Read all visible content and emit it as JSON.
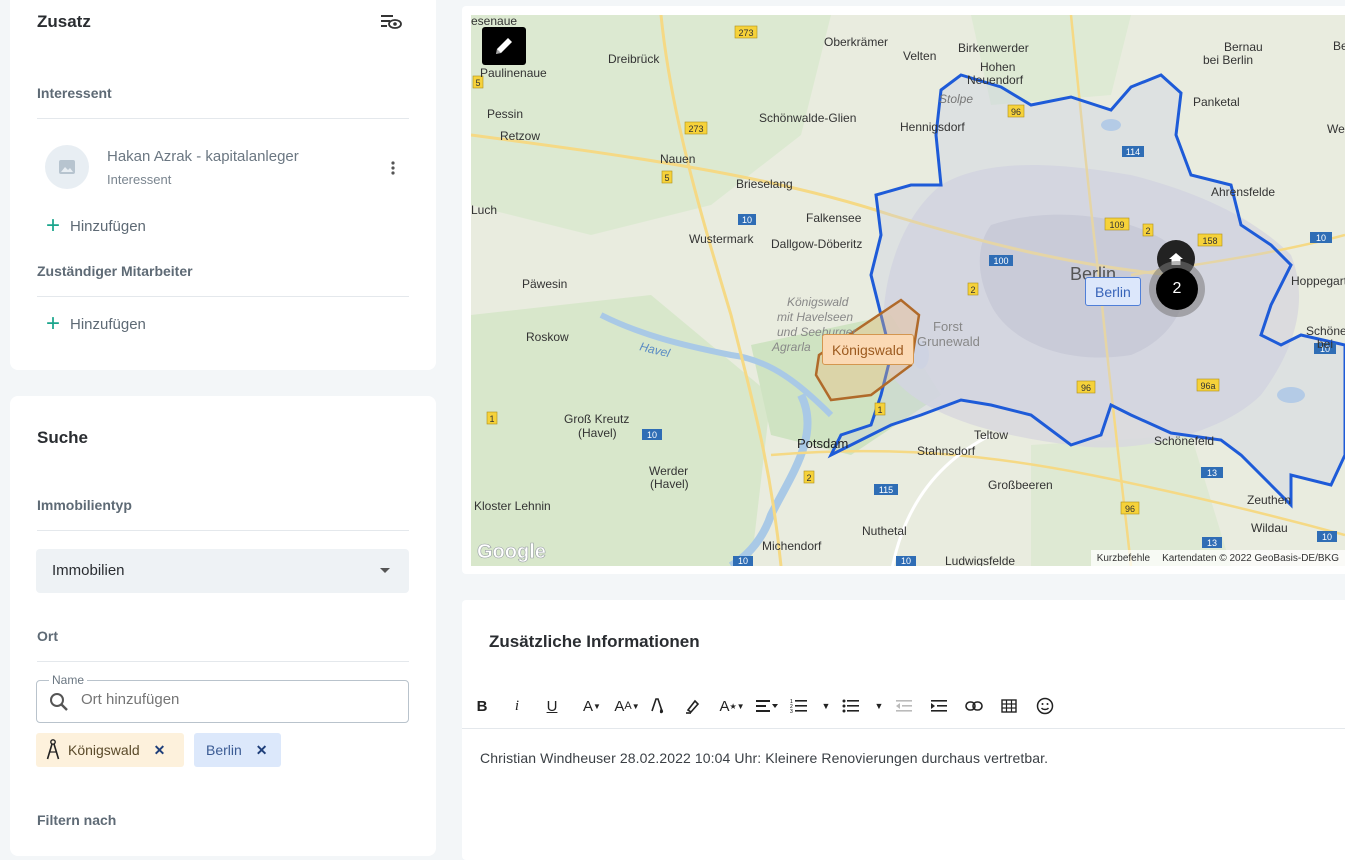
{
  "zusatz": {
    "title": "Zusatz",
    "interessent_label": "Interessent",
    "contact_name": "Hakan Azrak - kapitalanleger",
    "contact_role": "Interessent",
    "add_label_1": "Hinzufügen",
    "mitarbeiter_label": "Zuständiger Mitarbeiter",
    "add_label_2": "Hinzufügen"
  },
  "suche": {
    "title": "Suche",
    "immobilientyp_label": "Immobilientyp",
    "immobilientyp_value": "Immobilien",
    "ort_label": "Ort",
    "name_field_label": "Name",
    "ort_placeholder": "Ort hinzufügen",
    "chips": [
      "Königswald",
      "Berlin"
    ],
    "filter_label": "Filtern nach"
  },
  "map": {
    "labels": {
      "esenaue": "esenaue",
      "oberkraemer": "Oberkrämer",
      "birkenwerder": "Birkenwerder",
      "bernau": "Bernau",
      "bei_berlin": "bei Berlin",
      "be": "Be",
      "dreibrueck": "Dreibrück",
      "velten": "Velten",
      "hohen": "Hohen",
      "neuendorf": "Neuendorf",
      "paulinenaue": "Paulinenaue",
      "stolpe": "Stolpe",
      "panketal": "Panketal",
      "pessin": "Pessin",
      "schoenwalde": "Schönwalde-Glien",
      "hennigsdorf": "Hennigsdorf",
      "we": "We",
      "retzow": "Retzow",
      "nauen": "Nauen",
      "brieselang": "Brieselang",
      "ahrensfelde": "Ahrensfelde",
      "luch": "Luch",
      "falkensee": "Falkensee",
      "wustermark": "Wustermark",
      "dallgow": "Dallgow-Döberitz",
      "berlin": "Berlin",
      "hoppegarten": "Hoppegarte",
      "paewesin": "Päwesin",
      "koenigswald_1": "Königswald",
      "koenigswald_2": "mit Havelseen",
      "koenigswald_3": "und Seeburger",
      "koenigswald_4": "Agrarla",
      "forst": "Forst",
      "grunewald": "Grunewald",
      "roskow": "Roskow",
      "havel": "Havel",
      "schoene": "Schöne",
      "bei": "bei",
      "gross_kreutz": "Groß Kreutz",
      "havel_paren": "(Havel)",
      "teltow": "Teltow",
      "schoenefeld": "Schönefeld",
      "potsdam": "Potsdam",
      "stahnsdorf": "Stahnsdorf",
      "werder": "Werder",
      "werder_paren": "(Havel)",
      "grossbeeren": "Großbeeren",
      "zeuthen": "Zeuthen",
      "kloster": "Kloster Lehnin",
      "nuthetal": "Nuthetal",
      "wildau": "Wildau",
      "michendorf": "Michendorf",
      "ludwigsfelde": "Ludwigsfelde",
      "google": "Google",
      "kurzbefehle": "Kurzbefehle",
      "kartendaten": "Kartendaten © 2022 GeoBasis-DE/BKG"
    },
    "shields": [
      "273",
      "96",
      "273",
      "5",
      "5",
      "10",
      "114",
      "109",
      "2",
      "158",
      "10",
      "100",
      "10",
      "2",
      "96",
      "96a",
      "1",
      "1",
      "10",
      "2",
      "115",
      "13",
      "96",
      "13",
      "10",
      "10",
      "10"
    ],
    "marker_berlin": "Berlin",
    "marker_koenigswald": "Königswald",
    "cluster_count": "2"
  },
  "info": {
    "title": "Zusätzliche Informationen",
    "note": "Christian Windheuser 28.02.2022 10:04 Uhr: Kleinere Renovierungen durchaus vertretbar."
  },
  "colors": {
    "accent": "#1aa58c",
    "boundary": "#1e5bd8",
    "polygon": "#b06a2a"
  }
}
